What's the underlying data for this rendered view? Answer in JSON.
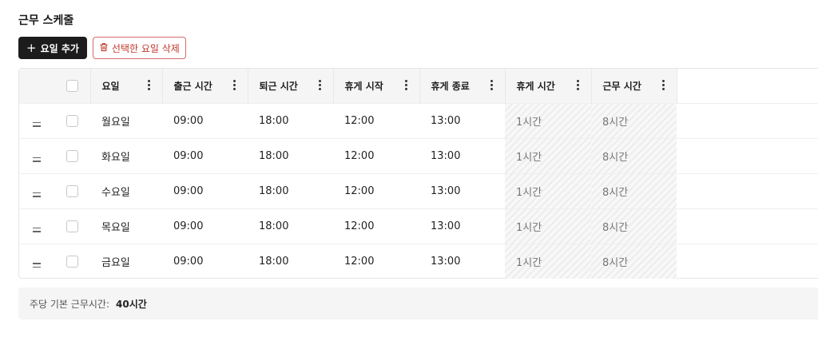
{
  "section_title": "근무 스케줄",
  "toolbar": {
    "add_label": "요일 추가",
    "delete_label": "선택한 요일 삭제"
  },
  "columns": [
    "요일",
    "출근 시간",
    "퇴근 시간",
    "휴게 시작",
    "휴게 종료",
    "휴게 시간",
    "근무 시간"
  ],
  "rows": [
    {
      "day": "월요일",
      "start": "09:00",
      "end": "18:00",
      "break_start": "12:00",
      "break_end": "13:00",
      "break_time": "1시간",
      "work_time": "8시간"
    },
    {
      "day": "화요일",
      "start": "09:00",
      "end": "18:00",
      "break_start": "12:00",
      "break_end": "13:00",
      "break_time": "1시간",
      "work_time": "8시간"
    },
    {
      "day": "수요일",
      "start": "09:00",
      "end": "18:00",
      "break_start": "12:00",
      "break_end": "13:00",
      "break_time": "1시간",
      "work_time": "8시간"
    },
    {
      "day": "목요일",
      "start": "09:00",
      "end": "18:00",
      "break_start": "12:00",
      "break_end": "13:00",
      "break_time": "1시간",
      "work_time": "8시간"
    },
    {
      "day": "금요일",
      "start": "09:00",
      "end": "18:00",
      "break_start": "12:00",
      "break_end": "13:00",
      "break_time": "1시간",
      "work_time": "8시간"
    }
  ],
  "footer": {
    "label": "주당 기본 근무시간:",
    "value": "40시간"
  },
  "colors": {
    "primary_button": "#1c1c1c",
    "danger": "#c0392b",
    "header_bg": "#f5f5f5"
  }
}
